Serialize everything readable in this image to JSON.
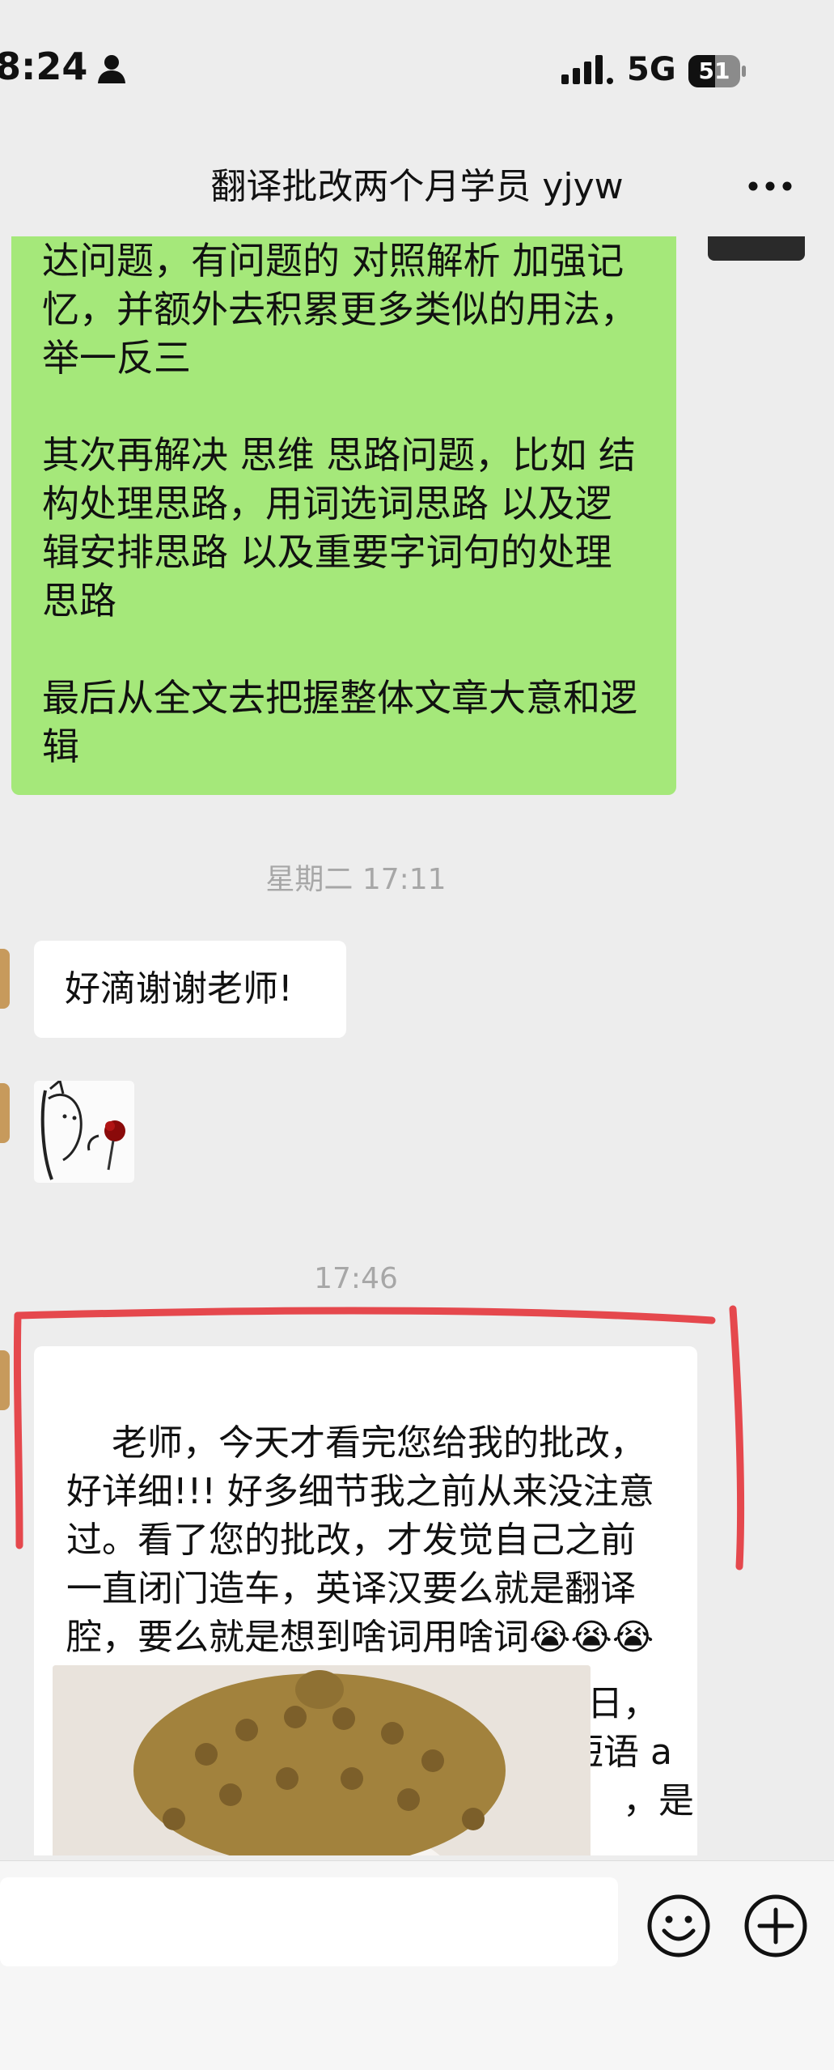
{
  "status_bar": {
    "time": "8:24",
    "network": "5G",
    "battery": "51",
    "battery_level_percent": 51
  },
  "nav": {
    "title": "翻译批改两个月学员 yjyw"
  },
  "messages": {
    "teacher_advice": "达问题，有问题的 对照解析 加强记忆，并额外去积累更多类似的用法，举一反三\n\n其次再解决 思维 思路问题，比如 结构处理思路，用词选词思路 以及逻辑安排思路 以及重要字词句的处理思路\n\n最后从全文去把握整体文章大意和逻辑",
    "timestamp_1": "星期二 17:11",
    "student_thanks": "好滴谢谢老师!",
    "timestamp_2": "17:46",
    "student_long": "老师，今天才看完您给我的批改，好详细!!! 好多细节我之前从来没注意过。看了您的批改，才发觉自己之前一直闭门造车，英译汉要么就是翻译腔，要么就是想到啥词用啥词😭😭😭感谢老师!!🐧🐧🐧老",
    "partial_line_1": "日，",
    "partial_line_2": "短语 a",
    "partial_line_3": "，是"
  },
  "icons": {
    "person": "person-icon",
    "signal": "signal-icon",
    "more": "more-icon",
    "emoji": "emoji-icon",
    "plus": "plus-icon"
  },
  "colors": {
    "background": "#ededed",
    "sent_bubble": "#a5e87a",
    "received_bubble": "#ffffff",
    "highlight": "#e5484d"
  }
}
